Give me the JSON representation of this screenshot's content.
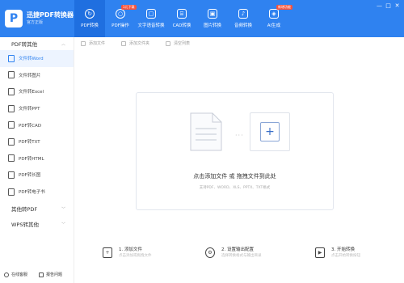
{
  "app": {
    "name": "迅捷PDF转换器",
    "version": "官方正版"
  },
  "nav": {
    "tabs": [
      {
        "label": "PDF转换",
        "icon": "pdf-convert-icon",
        "active": true
      },
      {
        "label": "PDF操作",
        "icon": "pdf-operate-icon",
        "badge": "1元下载"
      },
      {
        "label": "文字语音转换",
        "icon": "voice-icon"
      },
      {
        "label": "CAD转换",
        "icon": "cad-icon"
      },
      {
        "label": "图片转换",
        "icon": "image-icon"
      },
      {
        "label": "音频转换",
        "icon": "audio-icon"
      },
      {
        "label": "AI生成",
        "icon": "ai-icon",
        "badge": "新增功能"
      }
    ],
    "window_controls": [
      "—",
      "□",
      "✕"
    ]
  },
  "sidebar": {
    "section1": "PDF转其他",
    "items": [
      "文件转Word",
      "文件转图片",
      "文件转Excel",
      "文件转PPT",
      "PDF转CAD",
      "PDF转TXT",
      "PDF转HTML",
      "PDF转长图",
      "PDF转电子书"
    ],
    "section2": "其他转PDF",
    "section3": "WPS转其他"
  },
  "toolbar": {
    "add_files": "添加文件",
    "add_folder": "添加文件夹",
    "clear": "清空列表"
  },
  "dropzone": {
    "hint": "点击添加文件 或 拖拽文件到此处",
    "formats": "支持PDF、WORD、XLS、PPTX、TXT格式"
  },
  "steps": [
    {
      "title": "1. 添加文件",
      "sub": "点击添加或拖拽文件",
      "icon": "add-file-icon"
    },
    {
      "title": "2. 设置输出配置",
      "sub": "选择转换格式与输出目录",
      "icon": "gear-icon"
    },
    {
      "title": "3. 开始转换",
      "sub": "点击开始转换按钮",
      "icon": "start-icon"
    }
  ],
  "bottom": {
    "online_service": "在线客服",
    "feedback": "报告问题"
  },
  "colors": {
    "primary": "#2f82f0",
    "active_tab": "#1f6fe0",
    "badge": "#f5533d"
  }
}
